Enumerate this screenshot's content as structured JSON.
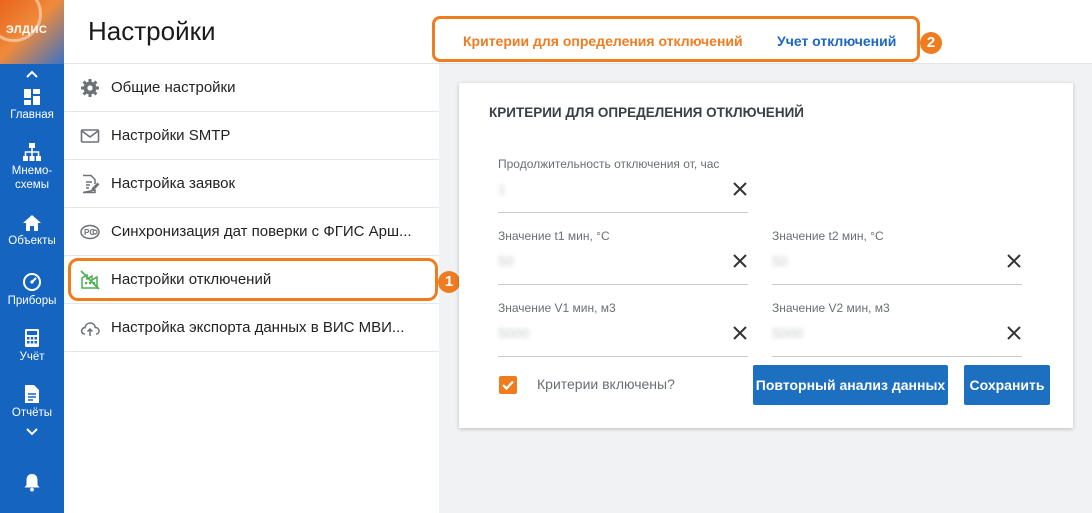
{
  "logo": {
    "text": "ЭЛДИС"
  },
  "rail": {
    "items": [
      {
        "label": "Главная",
        "icon": "dashboard-icon"
      },
      {
        "label": "Мнемо-",
        "label2": "схемы",
        "icon": "hierarchy-icon"
      },
      {
        "label": "Объекты",
        "icon": "home-icon"
      },
      {
        "label": "Приборы",
        "icon": "gauge-icon"
      },
      {
        "label": "Учёт",
        "icon": "calculator-icon"
      },
      {
        "label": "Отчёты",
        "icon": "document-icon"
      }
    ]
  },
  "header": {
    "title": "Настройки",
    "tabs": [
      {
        "label": "Критерии для определения отключений",
        "active": true
      },
      {
        "label": "Учет отключений",
        "active": false
      }
    ],
    "badge": "2"
  },
  "settings": {
    "items": [
      {
        "label": "Общие настройки",
        "icon": "gear-icon"
      },
      {
        "label": "Настройки SMTP",
        "icon": "mail-icon"
      },
      {
        "label": "Настройка заявок",
        "icon": "edit-document-icon"
      },
      {
        "label": "Синхронизация дат поверки с ФГИС Арш...",
        "icon": "sync-badge-icon"
      },
      {
        "label": "Настройки отключений",
        "icon": "disconnect-icon"
      },
      {
        "label": "Настройка экспорта данных в ВИС МВИ...",
        "icon": "cloud-upload-icon"
      }
    ],
    "badge": "1"
  },
  "card": {
    "title": "КРИТЕРИИ ДЛЯ ОПРЕДЕЛЕНИЯ ОТКЛЮЧЕНИЙ",
    "fields": {
      "duration": {
        "label": "Продолжительность отключения от, час",
        "value": "1"
      },
      "t1": {
        "label": "Значение t1 мин, °C",
        "value": "50"
      },
      "t2": {
        "label": "Значение t2 мин, °C",
        "value": "50"
      },
      "v1": {
        "label": "Значение V1 мин, м3",
        "value": "5000"
      },
      "v2": {
        "label": "Значение V2 мин, м3",
        "value": "5000"
      }
    },
    "criteria_label": "Критерии включены?",
    "criteria_checked": true,
    "reanalyze_button": "Повторный анализ данных",
    "save_button": "Сохранить"
  },
  "colors": {
    "accent": "#f07c20",
    "primary": "#1d6fbf",
    "rail": "#1565c0"
  }
}
